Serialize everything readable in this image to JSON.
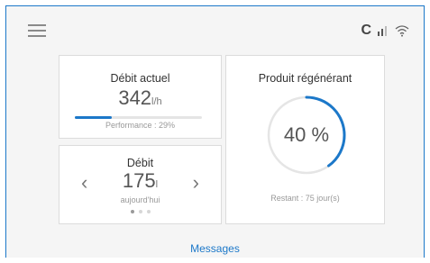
{
  "header": {
    "menu_icon": "hamburger-menu-icon",
    "status_letter": "C",
    "signal_icon": "signal-strength-icon",
    "wifi_icon": "wifi-icon"
  },
  "cards": {
    "current_flow": {
      "title": "Débit actuel",
      "value": "342",
      "unit": "l/h",
      "performance_label": "Performance : 29%",
      "performance_fraction": 0.29
    },
    "daily_flow": {
      "title": "Débit",
      "value": "175",
      "unit": "l",
      "caption": "aujourd'hui",
      "prev_icon": "chevron-left-icon",
      "next_icon": "chevron-right-icon",
      "pages": 3,
      "active_page": 0
    },
    "regenerant": {
      "title": "Produit régénérant",
      "percent_label": "40 %",
      "percent": 40,
      "remaining": "Restant : 75 jour(s)"
    }
  },
  "footer": {
    "messages_label": "Messages"
  },
  "colors": {
    "accent": "#1c78c9",
    "track": "#e5e5e5",
    "background": "#f5f5f5"
  }
}
